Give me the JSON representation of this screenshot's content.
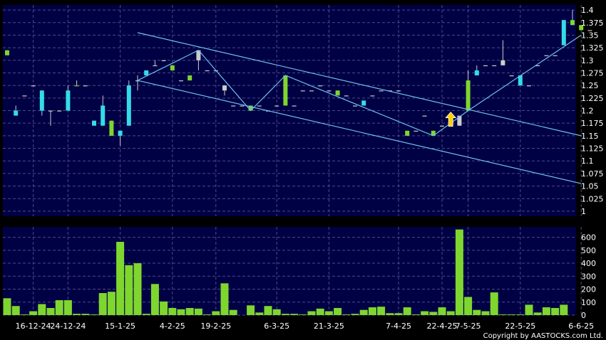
{
  "chart_data": [
    {
      "type": "candlestick",
      "panel": "price",
      "y_ticks": [
        1.4,
        1.375,
        1.35,
        1.325,
        1.3,
        1.275,
        1.25,
        1.225,
        1.2,
        1.175,
        1.15,
        1.125,
        1.1,
        1.075,
        1.05,
        1.025,
        1
      ],
      "ylim": [
        0.99,
        1.41
      ],
      "grid": true,
      "colors": {
        "background": "#000044",
        "grid": "#4a4a8a",
        "up": "#7fd62e",
        "down": "#33dde8",
        "doji": "#cccccc",
        "line": "#6cc0f0",
        "arrow": "#ffd000"
      },
      "candles": [
        {
          "o": 1.32,
          "h": 1.32,
          "l": 1.31,
          "c": 1.31,
          "dir": "up"
        },
        {
          "o": 1.2,
          "h": 1.21,
          "l": 1.19,
          "c": 1.19,
          "dir": "down"
        },
        {
          "o": 1.23,
          "h": 1.23,
          "l": 1.23,
          "c": 1.23,
          "dir": "flat"
        },
        {
          "o": 1.25,
          "h": 1.25,
          "l": 1.25,
          "c": 1.25,
          "dir": "flat"
        },
        {
          "o": 1.24,
          "h": 1.24,
          "l": 1.19,
          "c": 1.2,
          "dir": "down"
        },
        {
          "o": 1.2,
          "h": 1.2,
          "l": 1.17,
          "c": 1.2,
          "dir": "flat"
        },
        {
          "o": 1.2,
          "h": 1.2,
          "l": 1.2,
          "c": 1.2,
          "dir": "flat"
        },
        {
          "o": 1.24,
          "h": 1.25,
          "l": 1.2,
          "c": 1.2,
          "dir": "down"
        },
        {
          "o": 1.25,
          "h": 1.26,
          "l": 1.25,
          "c": 1.25,
          "dir": "up"
        },
        {
          "o": 1.25,
          "h": 1.25,
          "l": 1.25,
          "c": 1.25,
          "dir": "flat"
        },
        {
          "o": 1.18,
          "h": 1.18,
          "l": 1.17,
          "c": 1.17,
          "dir": "down"
        },
        {
          "o": 1.21,
          "h": 1.23,
          "l": 1.17,
          "c": 1.17,
          "dir": "down"
        },
        {
          "o": 1.18,
          "h": 1.18,
          "l": 1.15,
          "c": 1.15,
          "dir": "up"
        },
        {
          "o": 1.16,
          "h": 1.16,
          "l": 1.13,
          "c": 1.15,
          "dir": "down"
        },
        {
          "o": 1.25,
          "h": 1.26,
          "l": 1.17,
          "c": 1.17,
          "dir": "down"
        },
        {
          "o": 1.26,
          "h": 1.27,
          "l": 1.24,
          "c": 1.26,
          "dir": "flat"
        },
        {
          "o": 1.28,
          "h": 1.28,
          "l": 1.27,
          "c": 1.27,
          "dir": "down"
        },
        {
          "o": 1.29,
          "h": 1.3,
          "l": 1.29,
          "c": 1.29,
          "dir": "flat"
        },
        {
          "o": 1.3,
          "h": 1.3,
          "l": 1.3,
          "c": 1.3,
          "dir": "flat"
        },
        {
          "o": 1.29,
          "h": 1.29,
          "l": 1.28,
          "c": 1.28,
          "dir": "up"
        },
        {
          "o": 1.26,
          "h": 1.26,
          "l": 1.26,
          "c": 1.26,
          "dir": "flat"
        },
        {
          "o": 1.27,
          "h": 1.27,
          "l": 1.26,
          "c": 1.26,
          "dir": "up"
        },
        {
          "o": 1.32,
          "h": 1.32,
          "l": 1.28,
          "c": 1.3,
          "dir": "flat"
        },
        {
          "o": 1.28,
          "h": 1.28,
          "l": 1.28,
          "c": 1.28,
          "dir": "flat"
        },
        {
          "o": 1.28,
          "h": 1.28,
          "l": 1.28,
          "c": 1.28,
          "dir": "flat"
        },
        {
          "o": 1.25,
          "h": 1.25,
          "l": 1.23,
          "c": 1.24,
          "dir": "flat"
        },
        {
          "o": 1.21,
          "h": 1.21,
          "l": 1.21,
          "c": 1.21,
          "dir": "flat"
        },
        {
          "o": 1.21,
          "h": 1.21,
          "l": 1.21,
          "c": 1.21,
          "dir": "flat"
        },
        {
          "o": 1.21,
          "h": 1.21,
          "l": 1.2,
          "c": 1.2,
          "dir": "up"
        },
        {
          "o": 1.21,
          "h": 1.21,
          "l": 1.21,
          "c": 1.21,
          "dir": "flat"
        },
        {
          "o": 1.2,
          "h": 1.2,
          "l": 1.2,
          "c": 1.2,
          "dir": "flat"
        },
        {
          "o": 1.21,
          "h": 1.21,
          "l": 1.21,
          "c": 1.21,
          "dir": "flat"
        },
        {
          "o": 1.27,
          "h": 1.27,
          "l": 1.21,
          "c": 1.21,
          "dir": "up"
        },
        {
          "o": 1.21,
          "h": 1.21,
          "l": 1.21,
          "c": 1.21,
          "dir": "flat"
        },
        {
          "o": 1.24,
          "h": 1.24,
          "l": 1.24,
          "c": 1.24,
          "dir": "flat"
        },
        {
          "o": 1.24,
          "h": 1.24,
          "l": 1.24,
          "c": 1.24,
          "dir": "flat"
        },
        {
          "o": 1.25,
          "h": 1.25,
          "l": 1.25,
          "c": 1.25,
          "dir": "flat"
        },
        {
          "o": 1.24,
          "h": 1.24,
          "l": 1.24,
          "c": 1.24,
          "dir": "flat"
        },
        {
          "o": 1.24,
          "h": 1.24,
          "l": 1.23,
          "c": 1.23,
          "dir": "up"
        },
        {
          "o": 1.23,
          "h": 1.23,
          "l": 1.23,
          "c": 1.23,
          "dir": "flat"
        },
        {
          "o": 1.21,
          "h": 1.21,
          "l": 1.21,
          "c": 1.21,
          "dir": "flat"
        },
        {
          "o": 1.22,
          "h": 1.22,
          "l": 1.21,
          "c": 1.21,
          "dir": "down"
        },
        {
          "o": 1.23,
          "h": 1.23,
          "l": 1.23,
          "c": 1.23,
          "dir": "flat"
        },
        {
          "o": 1.24,
          "h": 1.24,
          "l": 1.24,
          "c": 1.24,
          "dir": "flat"
        },
        {
          "o": 1.24,
          "h": 1.24,
          "l": 1.24,
          "c": 1.24,
          "dir": "flat"
        },
        {
          "o": 1.24,
          "h": 1.24,
          "l": 1.24,
          "c": 1.24,
          "dir": "flat"
        },
        {
          "o": 1.16,
          "h": 1.16,
          "l": 1.15,
          "c": 1.15,
          "dir": "up"
        },
        {
          "o": 1.16,
          "h": 1.16,
          "l": 1.16,
          "c": 1.16,
          "dir": "flat"
        },
        {
          "o": 1.19,
          "h": 1.19,
          "l": 1.19,
          "c": 1.19,
          "dir": "flat"
        },
        {
          "o": 1.16,
          "h": 1.16,
          "l": 1.15,
          "c": 1.15,
          "dir": "up"
        },
        {
          "o": 1.17,
          "h": 1.17,
          "l": 1.17,
          "c": 1.17,
          "dir": "flat"
        },
        {
          "o": 1.18,
          "h": 1.18,
          "l": 1.18,
          "c": 1.18,
          "dir": "flat"
        },
        {
          "o": 1.19,
          "h": 1.19,
          "l": 1.17,
          "c": 1.17,
          "dir": "flat"
        },
        {
          "o": 1.26,
          "h": 1.28,
          "l": 1.2,
          "c": 1.2,
          "dir": "up"
        },
        {
          "o": 1.28,
          "h": 1.29,
          "l": 1.27,
          "c": 1.27,
          "dir": "down"
        },
        {
          "o": 1.29,
          "h": 1.29,
          "l": 1.29,
          "c": 1.29,
          "dir": "flat"
        },
        {
          "o": 1.29,
          "h": 1.29,
          "l": 1.29,
          "c": 1.29,
          "dir": "flat"
        },
        {
          "o": 1.3,
          "h": 1.34,
          "l": 1.29,
          "c": 1.29,
          "dir": "flat"
        },
        {
          "o": 1.27,
          "h": 1.27,
          "l": 1.27,
          "c": 1.27,
          "dir": "flat"
        },
        {
          "o": 1.27,
          "h": 1.27,
          "l": 1.25,
          "c": 1.25,
          "dir": "down"
        },
        {
          "o": 1.25,
          "h": 1.25,
          "l": 1.25,
          "c": 1.25,
          "dir": "flat"
        },
        {
          "o": 1.29,
          "h": 1.29,
          "l": 1.29,
          "c": 1.29,
          "dir": "flat"
        },
        {
          "o": 1.31,
          "h": 1.31,
          "l": 1.31,
          "c": 1.31,
          "dir": "flat"
        },
        {
          "o": 1.31,
          "h": 1.31,
          "l": 1.31,
          "c": 1.31,
          "dir": "flat"
        },
        {
          "o": 1.38,
          "h": 1.38,
          "l": 1.33,
          "c": 1.33,
          "dir": "down"
        },
        {
          "o": 1.38,
          "h": 1.4,
          "l": 1.37,
          "c": 1.37,
          "dir": "up"
        },
        {
          "o": 1.37,
          "h": 1.37,
          "l": 1.36,
          "c": 1.36,
          "dir": "up"
        },
        {
          "o": 1.36,
          "h": 1.36,
          "l": 1.36,
          "c": 1.36,
          "dir": "flat"
        }
      ],
      "overlay_lines": [
        {
          "from": [
            15,
            1.355
          ],
          "to": [
            66,
            1.15
          ]
        },
        {
          "from": [
            15,
            1.26
          ],
          "to": [
            66,
            1.055
          ]
        },
        {
          "points": [
            [
              15,
              1.26
            ],
            [
              22,
              1.32
            ],
            [
              28,
              1.2
            ],
            [
              32,
              1.27
            ],
            [
              49,
              1.15
            ],
            [
              53,
              1.2
            ],
            [
              66,
              1.35
            ]
          ]
        }
      ],
      "markers": [
        {
          "type": "up-arrow",
          "index": 51,
          "y": 1.18
        }
      ]
    },
    {
      "type": "bar",
      "panel": "volume",
      "y_ticks": [
        600,
        500,
        400,
        300,
        200,
        100,
        0
      ],
      "ylim": [
        0,
        680
      ],
      "grid": true,
      "x_ticks": [
        {
          "label": "16-12-24",
          "index": 3
        },
        {
          "label": "24-12-24",
          "index": 7
        },
        {
          "label": "15-1-25",
          "index": 13
        },
        {
          "label": "4-2-25",
          "index": 19
        },
        {
          "label": "19-2-25",
          "index": 24
        },
        {
          "label": "6-3-25",
          "index": 31
        },
        {
          "label": "21-3-25",
          "index": 37
        },
        {
          "label": "7-4-25",
          "index": 45
        },
        {
          "label": "22-4-25",
          "index": 50
        },
        {
          "label": "7-5-25",
          "index": 53
        },
        {
          "label": "22-5-25",
          "index": 59
        },
        {
          "label": "6-6-25",
          "index": 66
        }
      ],
      "values": [
        130,
        70,
        5,
        30,
        85,
        55,
        115,
        115,
        10,
        10,
        5,
        170,
        180,
        565,
        385,
        400,
        10,
        240,
        105,
        55,
        45,
        55,
        50,
        5,
        30,
        245,
        40,
        0,
        75,
        20,
        70,
        45,
        10,
        10,
        5,
        30,
        50,
        30,
        55,
        5,
        10,
        40,
        60,
        65,
        15,
        15,
        60,
        5,
        30,
        25,
        60,
        30,
        660,
        140,
        40,
        30,
        175,
        5,
        5,
        5,
        80,
        20,
        60,
        55,
        80
      ]
    }
  ],
  "copyright": "Copyright by AASTOCKS.com Ltd."
}
